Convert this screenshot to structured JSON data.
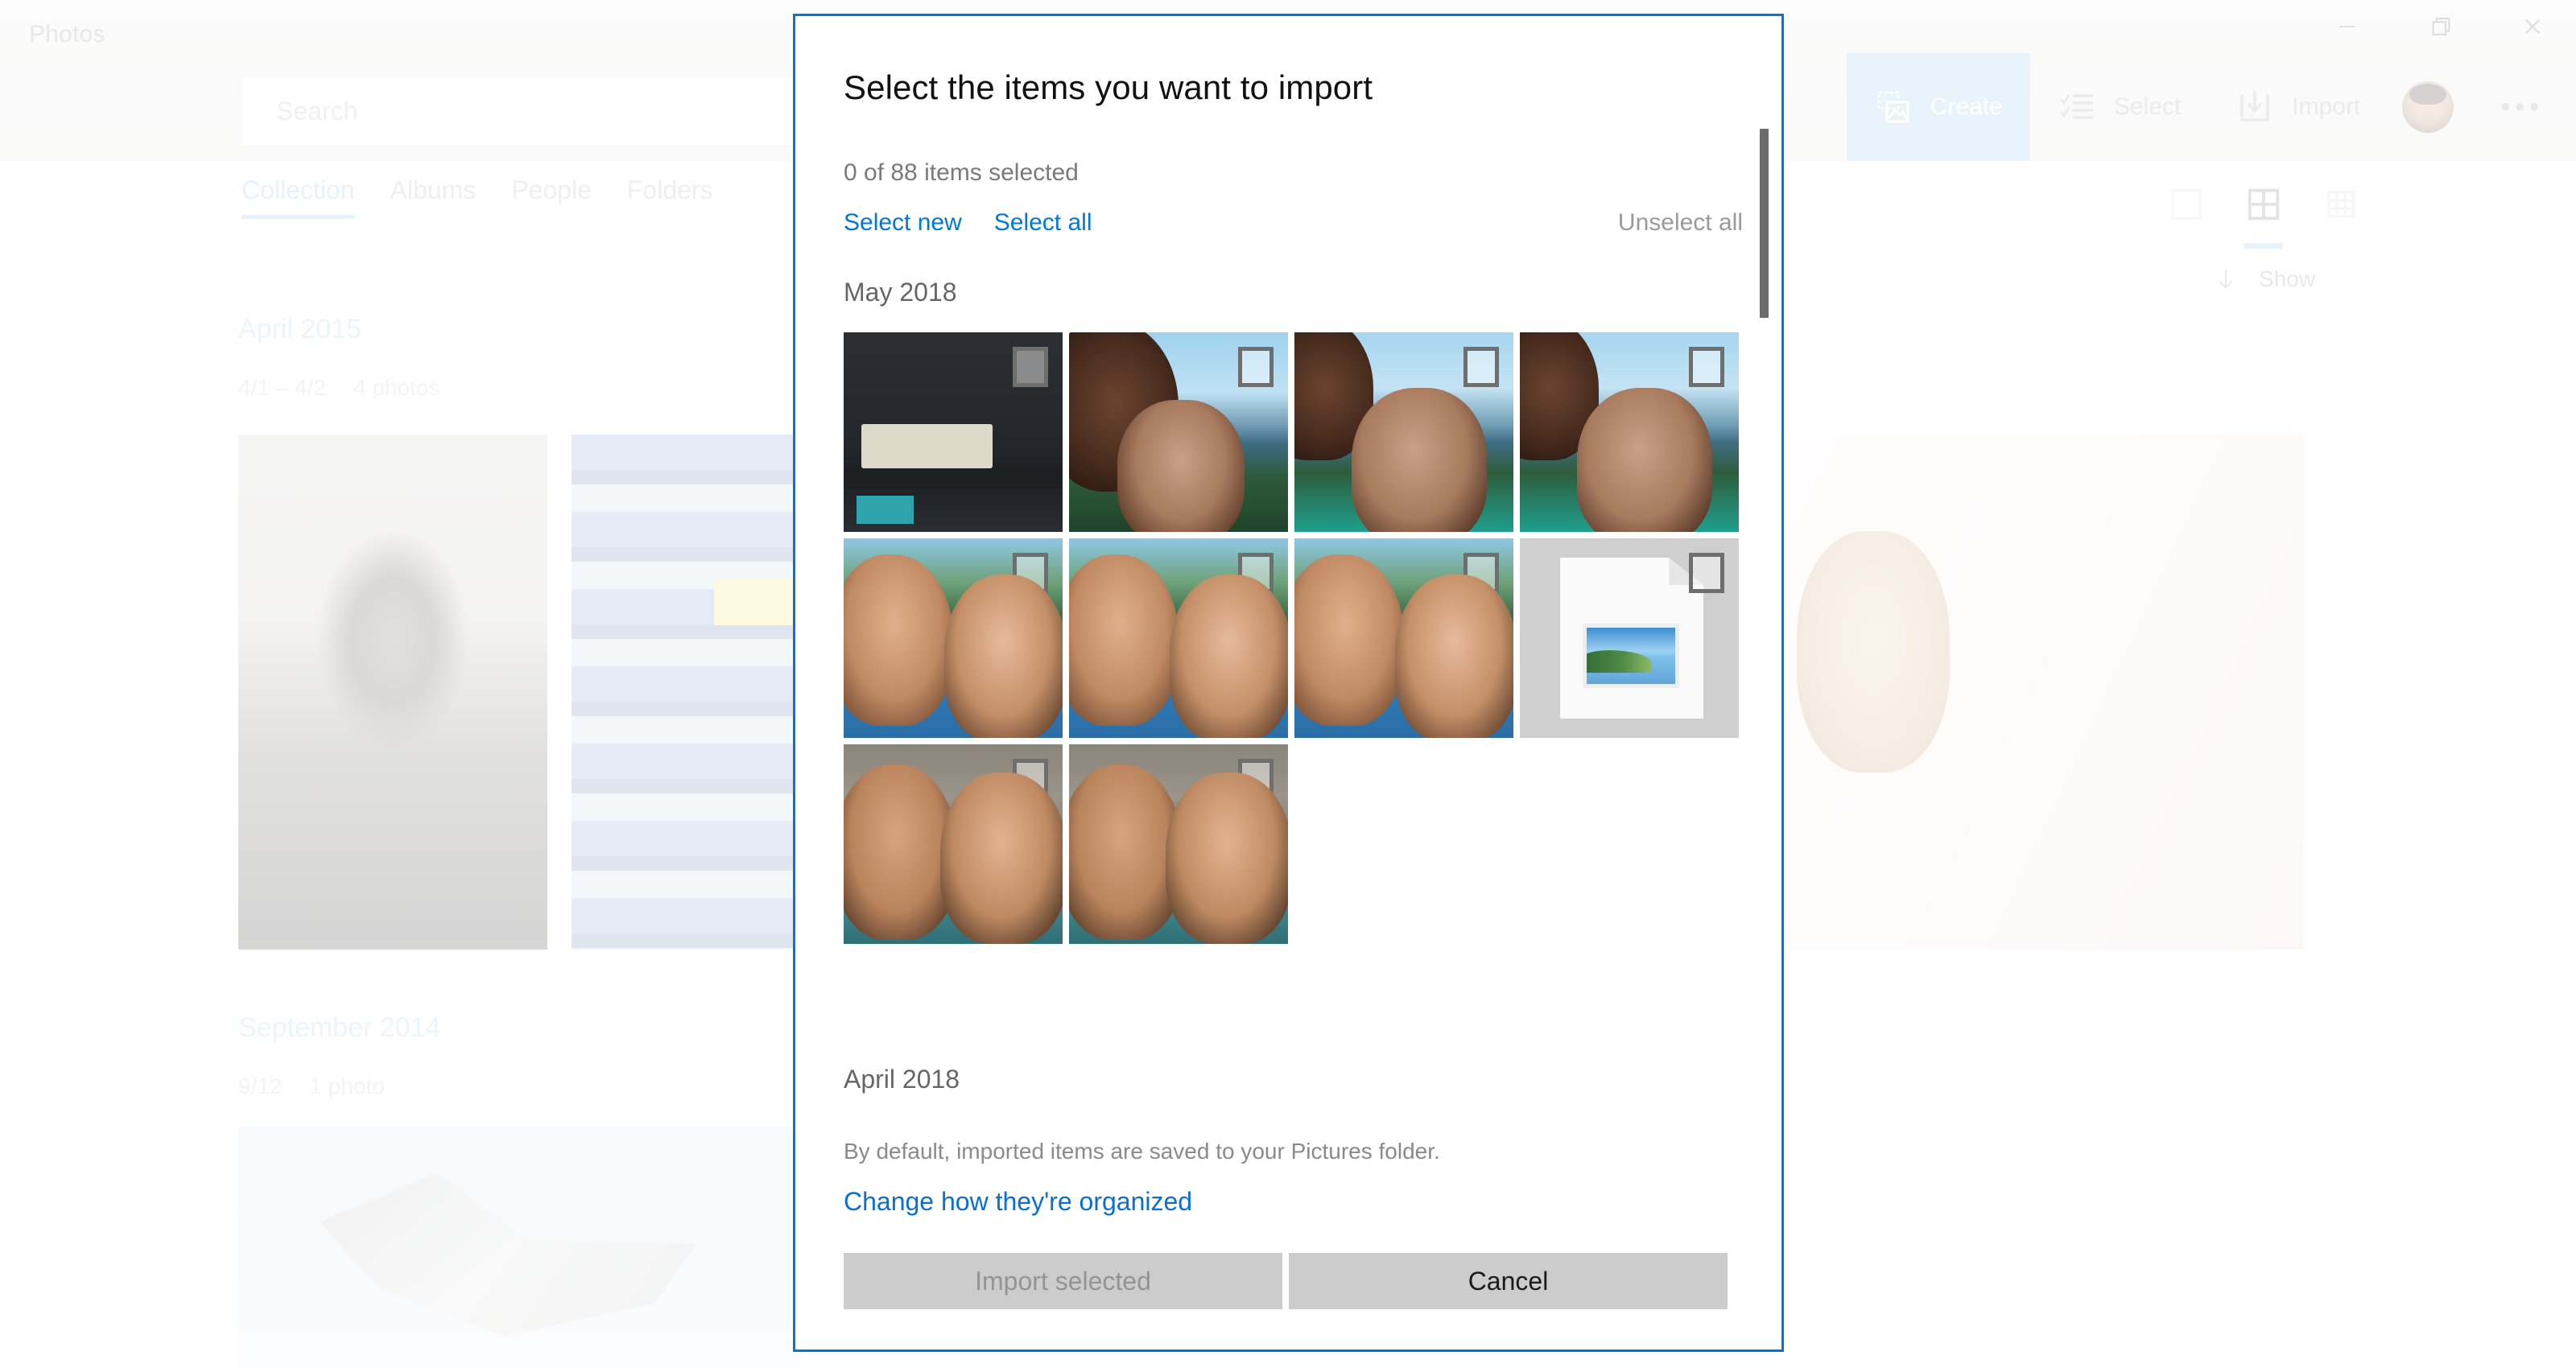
{
  "app": {
    "title": "Photos",
    "search": {
      "placeholder": "Search",
      "value": ""
    },
    "caption_buttons": [
      {
        "name": "minimize",
        "glyph": "minimize-icon"
      },
      {
        "name": "restore",
        "glyph": "restore-icon"
      },
      {
        "name": "close",
        "glyph": "close-icon"
      }
    ],
    "toolbar": [
      {
        "label": "Create",
        "icon": "create-icon",
        "accent": true
      },
      {
        "label": "Select",
        "icon": "select-icon",
        "accent": false
      },
      {
        "label": "Import",
        "icon": "import-icon",
        "accent": false
      }
    ],
    "more_glyph": "•••",
    "tabs": [
      {
        "label": "Collection",
        "active": true
      },
      {
        "label": "Albums",
        "active": false
      },
      {
        "label": "People",
        "active": false
      },
      {
        "label": "Folders",
        "active": false
      }
    ],
    "view_toggles": [
      {
        "icon": "single-tile-icon",
        "active": false
      },
      {
        "icon": "four-tile-grid-icon",
        "active": true
      },
      {
        "icon": "nine-tile-grid-icon",
        "active": false
      }
    ],
    "show_control": {
      "label": "Show",
      "icon": "arrow-down-icon"
    },
    "groups": [
      {
        "title": "April 2015",
        "date_range": "4/1 – 4/2",
        "count": "4 photos"
      },
      {
        "title": "September 2014",
        "date_range": "9/12",
        "count": "1 photo"
      }
    ]
  },
  "colors": {
    "accent_blue": "#0078d4",
    "light_blue": "#8cc4ef",
    "link_blue": "#0a6fd0",
    "button_gray": "#cccccc",
    "muted_text": "#9a9a9a"
  },
  "dialog": {
    "title": "Select the items you want to import",
    "count_text": "0 of 88 items selected",
    "select_new_label": "Select new",
    "select_all_label": "Select all",
    "unselect_all_label": "Unselect all",
    "month_heading_1": "May 2018",
    "month_heading_2": "April 2018",
    "footnote": "By default, imported items are saved to your Pictures folder.",
    "organize_link": "Change how they're organized",
    "import_button": "Import selected",
    "cancel_button": "Cancel",
    "thumbnails": [
      {
        "kind": "photo",
        "style": "p-coffee",
        "checked": false
      },
      {
        "kind": "photo",
        "style": "p-lake1",
        "checked": false
      },
      {
        "kind": "photo",
        "style": "p-lake2",
        "checked": false
      },
      {
        "kind": "photo",
        "style": "p-lake2",
        "checked": false
      },
      {
        "kind": "photo",
        "style": "p-couple",
        "checked": false
      },
      {
        "kind": "photo",
        "style": "p-couple",
        "checked": false
      },
      {
        "kind": "photo",
        "style": "p-couple",
        "checked": false
      },
      {
        "kind": "placeholder",
        "style": "",
        "checked": false
      },
      {
        "kind": "photo",
        "style": "p-road",
        "checked": false
      },
      {
        "kind": "photo",
        "style": "p-road",
        "checked": false
      }
    ]
  }
}
